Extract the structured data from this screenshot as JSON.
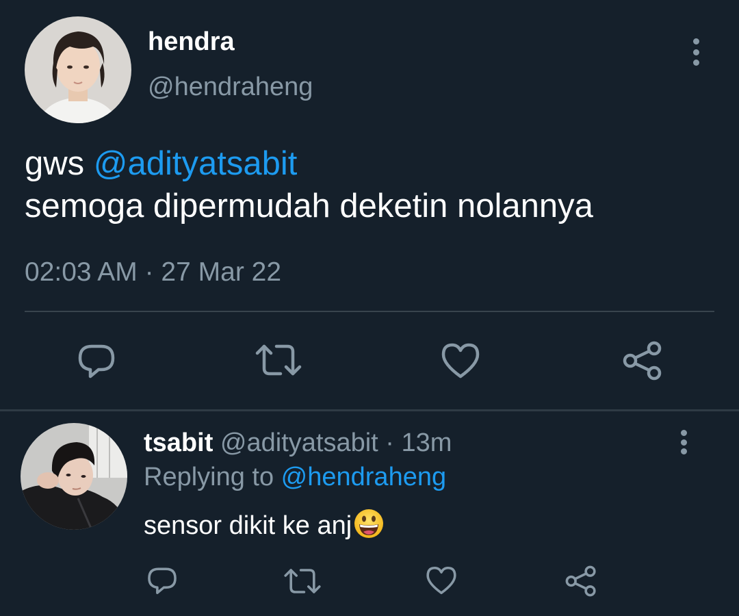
{
  "main_tweet": {
    "display_name": "hendra",
    "handle": "@hendraheng",
    "text_line1_prefix": "gws ",
    "text_line1_mention": "@adityatsabit",
    "text_line2": "semoga dipermudah deketin nolannya",
    "timestamp": "02:03 AM · 27 Mar 22",
    "actions": [
      "reply-icon",
      "retweet-icon",
      "like-icon",
      "share-icon"
    ]
  },
  "reply_tweet": {
    "display_name": "tsabit",
    "handle": "@adityatsabit",
    "separator": " · ",
    "time_ago": "13m",
    "replying_prefix": "Replying to ",
    "replying_mention": "@hendraheng",
    "text": "sensor dikit ke anj",
    "emoji": "grinning-face-icon",
    "actions": [
      "reply-icon",
      "retweet-icon",
      "like-icon",
      "share-icon"
    ]
  },
  "colors": {
    "background": "#15202b",
    "text_primary": "#ffffff",
    "text_secondary": "#8899a6",
    "accent": "#1d9bf0",
    "divider": "#38444d"
  }
}
